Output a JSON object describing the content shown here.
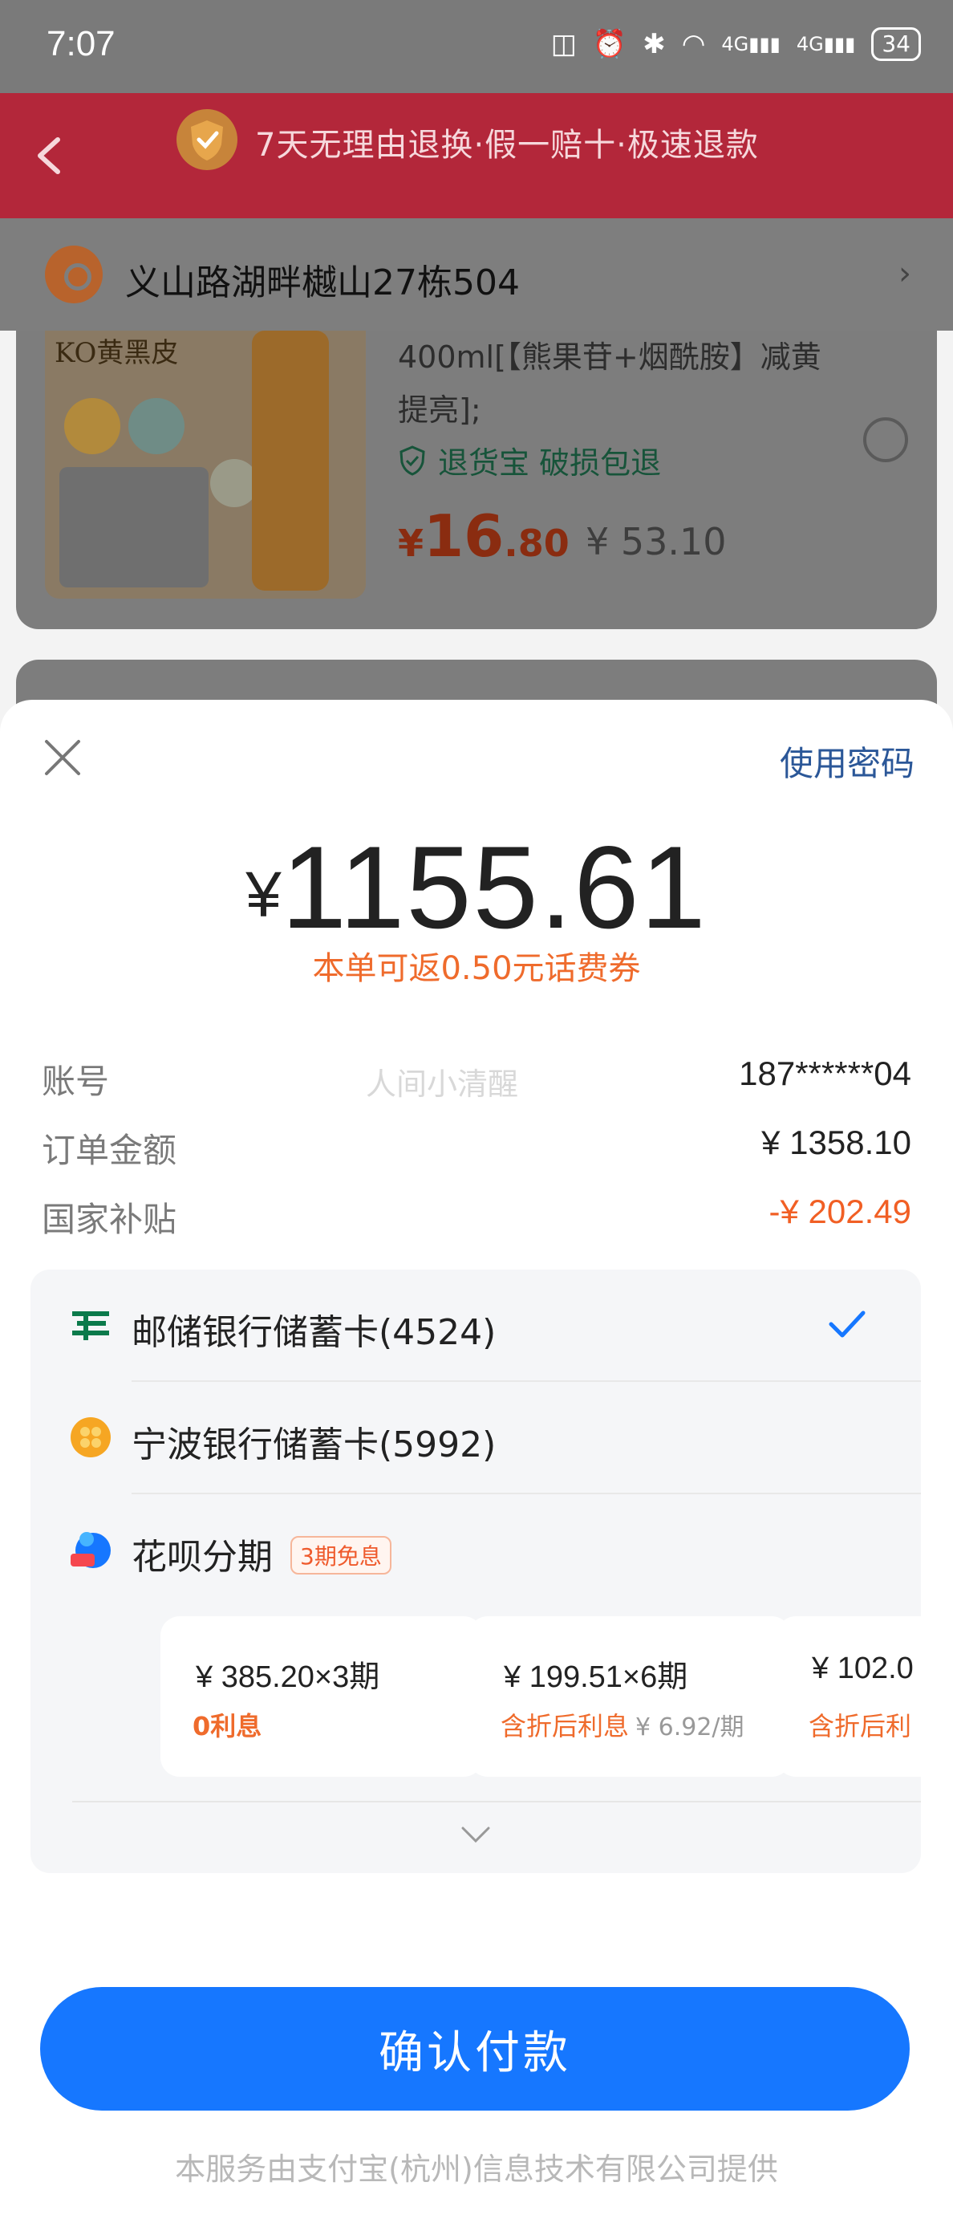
{
  "status_bar": {
    "time": "7:07",
    "battery": "34",
    "network": "4G"
  },
  "promo_banner": {
    "text": "7天无理由退换·假一赔十·极速退款"
  },
  "address": {
    "text": "义山路湖畔樾山27栋504"
  },
  "product": {
    "image_label": "KO黄黑皮",
    "description": "400ml[【熊果苷+烟酰胺】减黄提亮];",
    "guarantee": "退货宝 破损包退",
    "price_symbol": "¥",
    "price_int": "16",
    "price_dec": ".80",
    "original_price": "¥ 53.10"
  },
  "payment_sheet": {
    "use_password": "使用密码",
    "amount_symbol": "¥",
    "amount": "1155.61",
    "rebate": "本单可返0.50元话费券",
    "watermark": "人间小清醒",
    "rows": [
      {
        "label": "账号",
        "value": "187******04"
      },
      {
        "label": "订单金额",
        "value": "¥ 1358.10"
      },
      {
        "label": "国家补贴",
        "value": "-¥ 202.49"
      }
    ],
    "methods": [
      {
        "label": "邮储银行储蓄卡(4524)",
        "selected": true,
        "icon": "psbc-bank-icon"
      },
      {
        "label": "宁波银行储蓄卡(5992)",
        "selected": false,
        "icon": "ningbo-bank-icon"
      },
      {
        "label": "花呗分期",
        "badge": "3期免息",
        "icon": "huabei-icon"
      }
    ],
    "installment_plans": [
      {
        "amount": "¥ 385.20×3期",
        "interest": "0利息",
        "extra": ""
      },
      {
        "amount": "¥ 199.51×6期",
        "interest": "含折后利息",
        "extra": "¥ 6.92/期"
      },
      {
        "amount": "¥ 102.0",
        "interest": "含折后利",
        "extra": ""
      }
    ],
    "confirm_button": "确认付款",
    "footer": "本服务由支付宝(杭州)信息技术有限公司提供"
  },
  "colors": {
    "accent": "#1677ff",
    "orange": "#ef6b2c",
    "banner": "#b3273a",
    "link": "#2b5798"
  }
}
